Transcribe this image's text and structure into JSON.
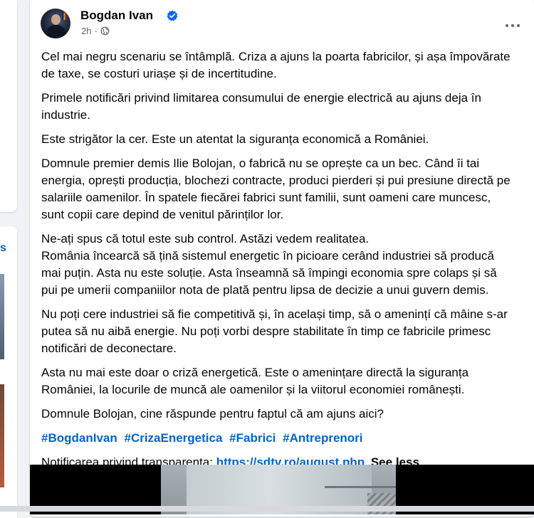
{
  "post": {
    "author": "Bogdan Ivan",
    "timestamp": "2h",
    "paragraphs": [
      "Cel mai negru scenariu se întâmplă. Criza a ajuns la poarta fabricilor, și așa împovărate de taxe, se costuri uriașe și de incertitudine.",
      "Primele notificări privind limitarea consumului de energie electrică au ajuns deja în industrie.",
      "Este strigător la cer. Este un atentat la siguranța economică a României.",
      "Domnule premier demis Ilie Bolojan, o fabrică nu se oprește ca un bec. Când îi tai energia, oprești producția, blochezi contracte, produci pierderi și pui presiune directă pe salariile oamenilor. În spatele fiecărei fabrici sunt familii, sunt oameni care muncesc, sunt copii care depind de venitul părinților lor.",
      "Ne-ați spus că totul este sub control. Astăzi vedem realitatea.",
      "România încearcă să țină sistemul energetic în picioare cerând industriei să producă mai puțin. Asta nu este soluție. Asta înseamnă să împingi economia spre colaps și să pui pe umerii companiilor nota de plată pentru lipsa de decizie a unui guvern demis.",
      "Nu poți cere industriei să fie competitivă și, în același timp, să o amenințí că mâine s-ar putea să nu aibă energie. Nu poți vorbi despre stabilitate în timp ce fabricile primesc notificări de deconectare.",
      "Asta nu mai este doar o criză energetică. Este o amenințare directă la siguranța României, la locurile de muncă ale oamenilor și la viitorul economiei românești.",
      "Domnule Bolojan, cine răspunde pentru faptul că am ajuns aici?"
    ],
    "hashtags": [
      "#BogdanIvan",
      "#CrizaEnergetica",
      "#Fabrici",
      "#Antreprenori"
    ],
    "transparency_label": "Notificarea privind transparența:",
    "transparency_link": "https://sdtv.ro/august.php",
    "see_less": "See less"
  },
  "left_fragment": {
    "letter": "s"
  },
  "icons": {
    "verified": "verified-badge-icon",
    "globe": "globe-icon",
    "more": "more-options-icon"
  },
  "colors": {
    "link": "#0064d1",
    "verified": "#0866ff",
    "meta": "#65676b",
    "background": "#f0f2f5"
  }
}
